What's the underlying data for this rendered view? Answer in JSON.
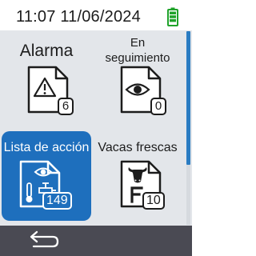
{
  "status": {
    "clock": "11:07 11/06/2024",
    "battery_icon": "battery-full-icon",
    "battery_level": 1.0,
    "battery_color": "#1fa32a"
  },
  "tiles": [
    {
      "label": "Alarma",
      "icon": "warning-document-icon",
      "count": "6",
      "selected": false
    },
    {
      "label_line1": "En",
      "label_line2": "seguimiento",
      "icon": "eye-document-icon",
      "count": "0",
      "selected": false
    },
    {
      "label": "Lista de acción",
      "icon": "eye-thermometer-syringe-document-icon",
      "count": "149",
      "selected": true
    },
    {
      "label": "Vacas frescas",
      "icon": "cow-f-document-icon",
      "count": "10",
      "selected": false
    }
  ],
  "nav": {
    "back_icon": "back-arrow-icon"
  },
  "colors": {
    "accent": "#1e6fbd",
    "grid_background": "#e3e6ea",
    "nav_background": "#4a4a53",
    "scrollbar_thumb": "#2a7cc2"
  }
}
